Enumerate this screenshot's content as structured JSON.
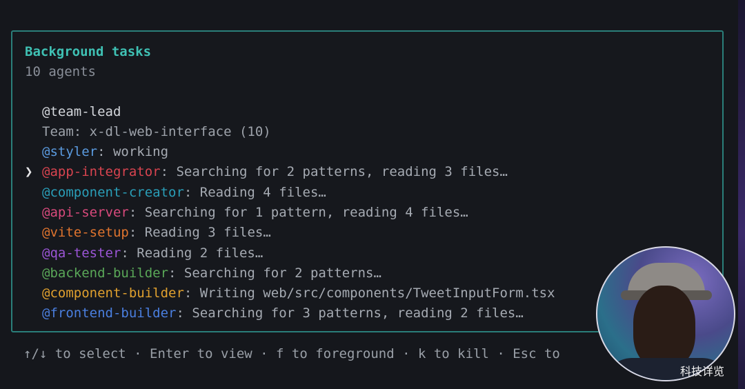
{
  "panel": {
    "title": "Background tasks",
    "subtitle": "10 agents",
    "lead": "@team-lead",
    "team": "Team: x-dl-web-interface (10)",
    "border_color": "#2a7f7a"
  },
  "agents": [
    {
      "handle": "@styler",
      "status": " working",
      "color": "#5b9be0",
      "selected": false
    },
    {
      "handle": "@app-integrator",
      "status": " Searching for 2 patterns, reading 3 files…",
      "color": "#d94450",
      "selected": true
    },
    {
      "handle": "@component-creator",
      "status": " Reading 4 files…",
      "color": "#2a9eb8",
      "selected": false
    },
    {
      "handle": "@api-server",
      "status": " Searching for 1 pattern, reading 4 files…",
      "color": "#d94a7c",
      "selected": false
    },
    {
      "handle": "@vite-setup",
      "status": " Reading 3 files…",
      "color": "#e0742e",
      "selected": false
    },
    {
      "handle": "@qa-tester",
      "status": " Reading 2 files…",
      "color": "#9b55d6",
      "selected": false
    },
    {
      "handle": "@backend-builder",
      "status": " Searching for 2 patterns…",
      "color": "#5aa858",
      "selected": false
    },
    {
      "handle": "@component-builder",
      "status": " Writing web/src/components/TweetInputForm.tsx",
      "color": "#e0a02e",
      "selected": false
    },
    {
      "handle": "@frontend-builder",
      "status": " Searching for 3 patterns, reading 2 files…",
      "color": "#4a7fe0",
      "selected": false
    }
  ],
  "pointer_glyph": "❯",
  "colon": ":",
  "footer": "↑/↓ to select · Enter to view · f to foreground · k to kill · Esc to",
  "watermark": "科技详览"
}
